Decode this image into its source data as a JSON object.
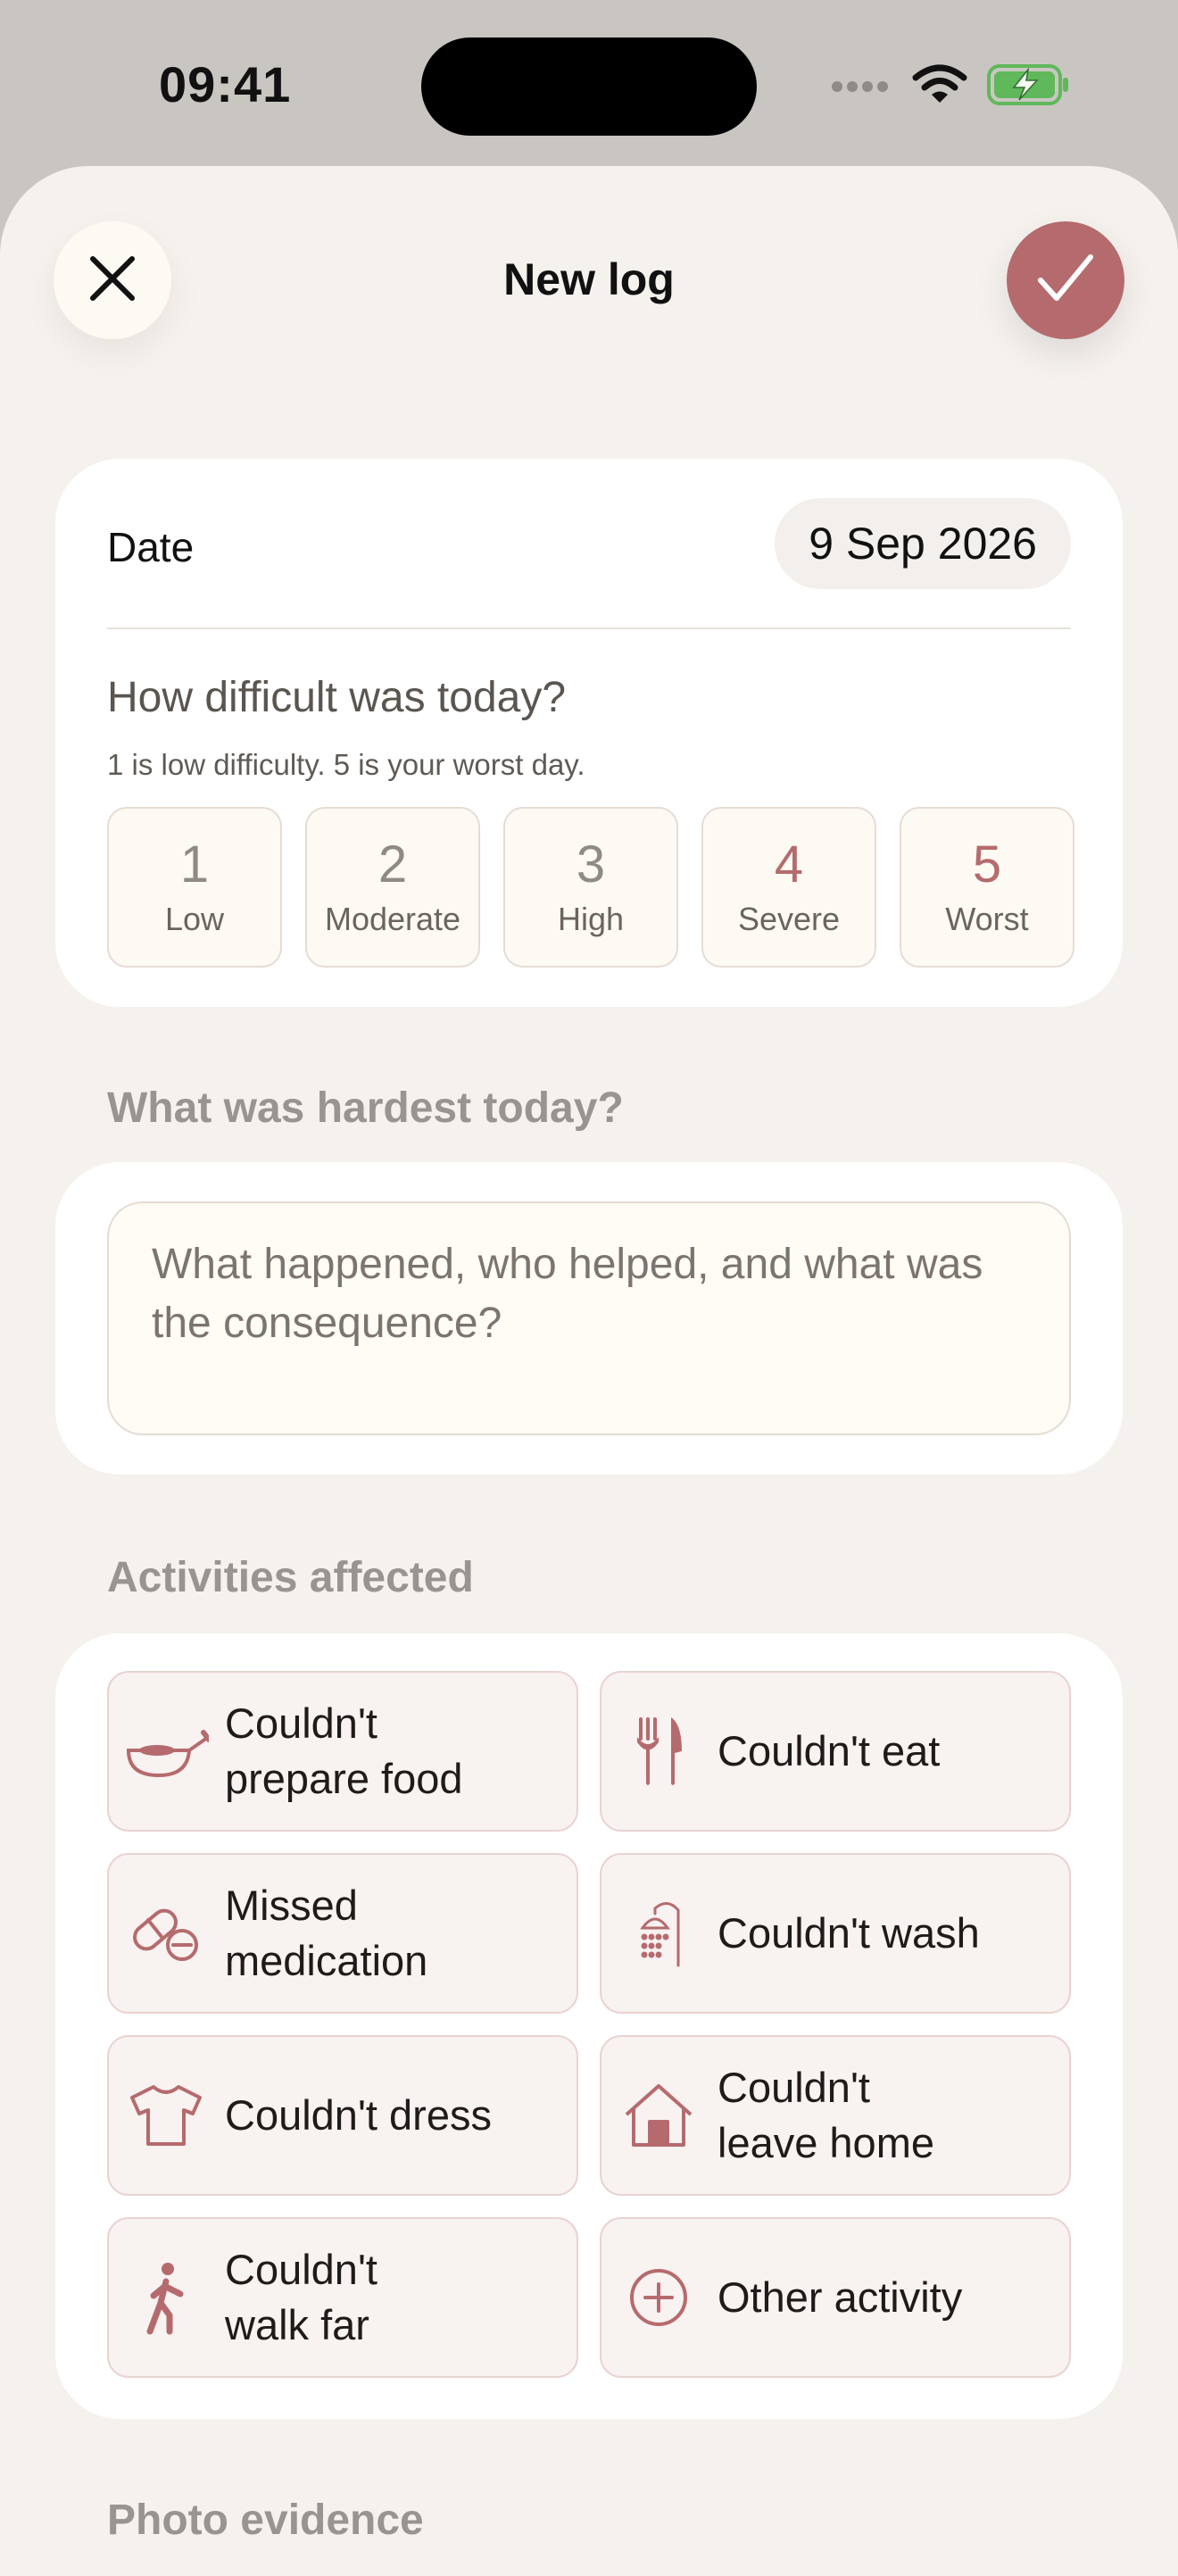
{
  "status_bar": {
    "time": "09:41"
  },
  "nav": {
    "title": "New log",
    "close_icon": "close-icon",
    "confirm_icon": "checkmark-icon"
  },
  "date_row": {
    "label": "Date",
    "value": "9 Sep 2026"
  },
  "difficulty": {
    "question": "How difficult was today?",
    "hint": "1 is low difficulty. 5 is your worst day.",
    "options": [
      {
        "number": "1",
        "label": "Low",
        "color": "#8e8a86"
      },
      {
        "number": "2",
        "label": "Moderate",
        "color": "#8e8a86"
      },
      {
        "number": "3",
        "label": "High",
        "color": "#8e8a86"
      },
      {
        "number": "4",
        "label": "Severe",
        "color": "#b56b6d"
      },
      {
        "number": "5",
        "label": "Worst",
        "color": "#b56b6d"
      }
    ]
  },
  "hardest": {
    "section_title": "What was hardest today?",
    "placeholder": "What happened, who helped, and what was the consequence?"
  },
  "activities": {
    "section_title": "Activities affected",
    "items": [
      {
        "label": "Couldn't\nprepare food",
        "icon": "cooking-pan-icon"
      },
      {
        "label": "Couldn't eat",
        "icon": "fork-knife-icon"
      },
      {
        "label": "Missed\nmedication",
        "icon": "pill-icon"
      },
      {
        "label": "Couldn't wash",
        "icon": "shower-icon"
      },
      {
        "label": "Couldn't dress",
        "icon": "tshirt-icon"
      },
      {
        "label": "Couldn't\nleave home",
        "icon": "house-icon"
      },
      {
        "label": "Couldn't\nwalk far",
        "icon": "walking-figure-icon"
      },
      {
        "label": "Other activity",
        "icon": "plus-circle-icon"
      }
    ]
  },
  "photo": {
    "section_title": "Photo evidence"
  },
  "colors": {
    "accent": "#b56b6d",
    "sheet_bg": "#f5f2ee",
    "card_bg": "#ffffff"
  }
}
